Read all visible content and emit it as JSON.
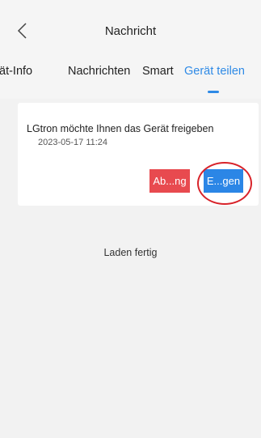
{
  "header": {
    "title": "Nachricht",
    "back_icon": "chevron-left-icon"
  },
  "tabs": [
    {
      "label": "ät-Info",
      "active": false
    },
    {
      "label": "Nachrichten",
      "active": false
    },
    {
      "label": "Smart",
      "active": false
    },
    {
      "label": "Gerät teilen",
      "active": true
    }
  ],
  "card": {
    "message": "LGtron möchte Ihnen das Gerät freigeben",
    "timestamp": "2023-05-17 11:24",
    "reject_label": "Ab...ng",
    "accept_label": "E...gen"
  },
  "status": "Laden fertig",
  "colors": {
    "accent": "#2e8ae6",
    "reject": "#e84a4f",
    "accept": "#2b86e6",
    "highlight": "#d8232a"
  }
}
